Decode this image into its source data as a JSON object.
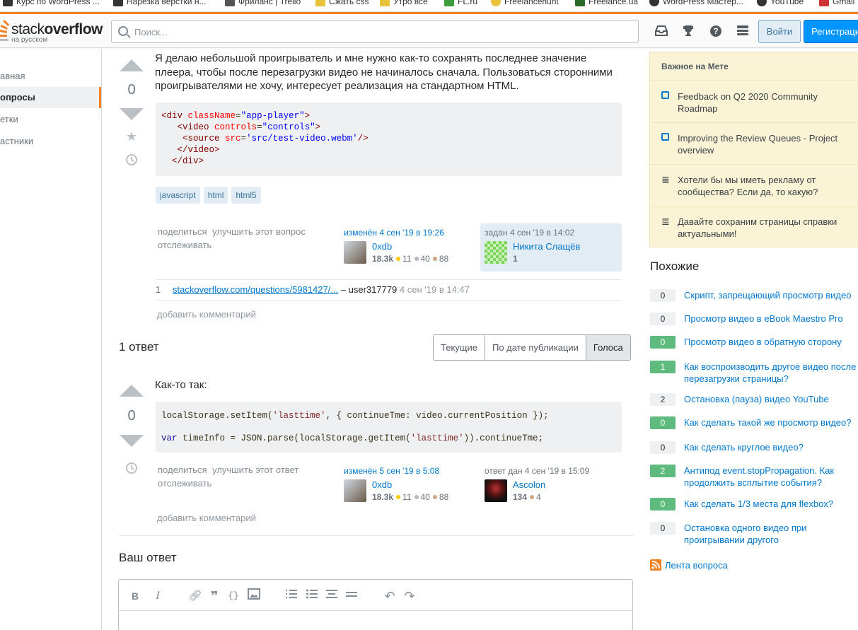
{
  "bookmarks": [
    {
      "label": "Курс по WordPress ...",
      "color": "#333"
    },
    {
      "label": "Нарезка верстки н...",
      "color": "#333"
    },
    {
      "label": "Фриланс | Trello",
      "color": "#555"
    },
    {
      "label": "Сжать css",
      "color": "#e8c33a"
    },
    {
      "label": "Утро все",
      "color": "#e8c33a"
    },
    {
      "label": "FL.ru",
      "color": "#3a9c3a"
    },
    {
      "label": "Freelancehunt",
      "color": "#e8c33a"
    },
    {
      "label": "Freelance.ua",
      "color": "#2b6a2b"
    },
    {
      "label": "WordPress Мастер...",
      "color": "#333"
    },
    {
      "label": "YouTube",
      "color": "#333"
    },
    {
      "label": "Gmail",
      "color": "#c33"
    }
  ],
  "header": {
    "logo_main_light": "stack",
    "logo_main_bold": "overflow",
    "logo_sub": "на русском",
    "search_placeholder": "Поиск...",
    "login": "Войти",
    "register": "Регистрация"
  },
  "nav": [
    "авная",
    "опросы",
    "етки",
    "астники"
  ],
  "question": {
    "votes": "0",
    "text": "Я делаю небольшой проигрыватель и мне нужно как-то сохранять последнее значение плеера, чтобы после перезагрузки видео не начиналось сначала. Пользоваться сторонними проигрывателями не хочу, интересует реализация на стандартном HTML.",
    "code_lines": [
      "<div className=\"app-player\">",
      "   <video controls=\"controls\">",
      "    <source src='src/test-video.webm'/>",
      "   </video>",
      "  </div>"
    ],
    "tags": [
      "javascript",
      "html",
      "html5"
    ],
    "menu": {
      "share": "поделиться",
      "improve": "улучшить этот вопрос",
      "follow": "отслеживать"
    },
    "edited": {
      "action": "изменён 4 сен '19 в 19:26",
      "name": "0xdb",
      "rep": "18.3k",
      "gold": "11",
      "silver": "40",
      "bronze": "88"
    },
    "asked": {
      "action": "задан 4 сен '19 в 14:02",
      "name": "Никита Слащёв",
      "rep": "1"
    },
    "comment": {
      "score": "1",
      "link": "stackoverflow.com/questions/5981427/...",
      "author": "– user317779",
      "date": "4 сен '19 в 14:47"
    },
    "add_comment": "добавить комментарий"
  },
  "answers": {
    "title": "1 ответ",
    "sort_tabs": [
      "Текущие",
      "По дате публикации",
      "Голоса"
    ]
  },
  "answer": {
    "votes": "0",
    "text": "Как-то так:",
    "code_line1": "localStorage.setItem('lasttime', { continueTme: video.currentPosition });",
    "code_line2": "var timeInfo = JSON.parse(localStorage.getItem('lasttime')).continueTme;",
    "menu": {
      "share": "поделиться",
      "improve": "улучшить этот ответ",
      "follow": "отслеживать"
    },
    "edited": {
      "action": "изменён 5 сен '19 в 5:08",
      "name": "0xdb",
      "rep": "18.3k",
      "gold": "11",
      "silver": "40",
      "bronze": "88"
    },
    "answered": {
      "action": "ответ дан 4 сен '19 в 15:09",
      "name": "Ascolon",
      "rep": "134",
      "bronze": "4"
    },
    "add_comment": "добавить комментарий"
  },
  "your_answer": "Ваш ответ",
  "meta": {
    "head": "Важное на Мете",
    "items": [
      "Feedback on Q2 2020 Community Roadmap",
      "Improving the Review Queues - Project overview",
      "Хотели бы мы иметь рекламу от сообщества? Если да, то какую?",
      "Давайте сохраним страницы справки актуальными!"
    ]
  },
  "similar": {
    "title": "Похожие",
    "items": [
      {
        "score": "0",
        "answered": false,
        "title": "Скрипт, запрещающий просмотр видео"
      },
      {
        "score": "0",
        "answered": false,
        "title": "Просмотр видео в eBook Maestro Pro"
      },
      {
        "score": "0",
        "answered": true,
        "title": "Просмотр видео в обратную сторону"
      },
      {
        "score": "1",
        "answered": true,
        "title": "Как воспроизводить другое видео после перезагрузки страницы?"
      },
      {
        "score": "2",
        "answered": false,
        "title": "Остановка (пауза) видео YouTube"
      },
      {
        "score": "0",
        "answered": true,
        "title": "Как сделать такой же просмотр видео?"
      },
      {
        "score": "0",
        "answered": false,
        "title": "Как сделать круглое видео?"
      },
      {
        "score": "2",
        "answered": true,
        "title": "Антипод event.stopPropagation. Как продолжить всплытие события?"
      },
      {
        "score": "0",
        "answered": true,
        "title": "Как сделать 1/3 места для flexbox?"
      },
      {
        "score": "0",
        "answered": false,
        "title": "Остановка одного видео при проигрывании другого"
      }
    ],
    "feed": "Лента вопроса"
  },
  "colors": {
    "accent": "#f48024",
    "link": "#0077cc",
    "answered": "#5eba7d"
  }
}
